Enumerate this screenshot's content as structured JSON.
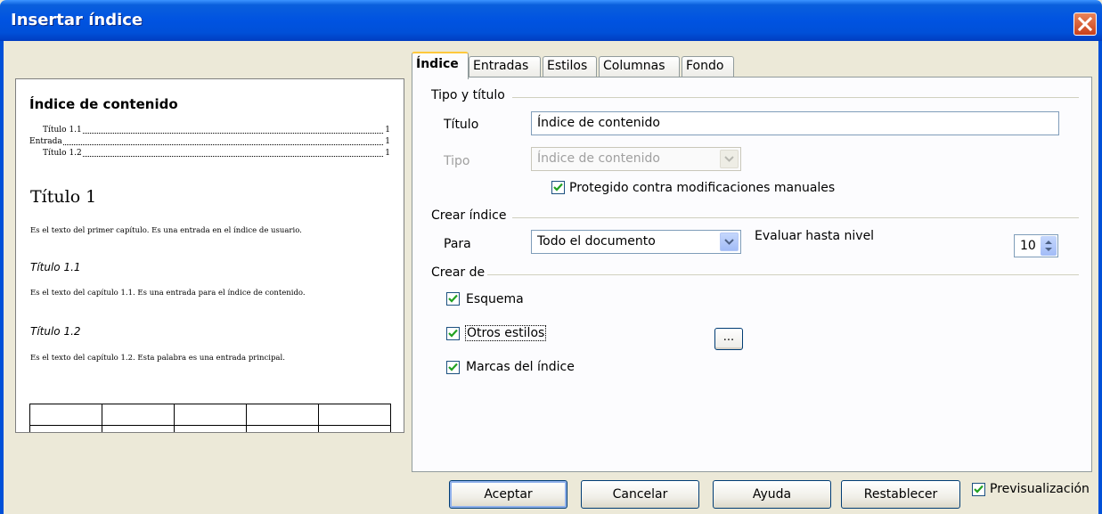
{
  "window": {
    "title": "Insertar índice"
  },
  "preview": {
    "index_heading": "Índice de contenido",
    "entries": [
      {
        "label": "Título 1.1",
        "page": "1"
      },
      {
        "label": "Entrada",
        "page": "1"
      },
      {
        "label": "Título 1.2",
        "page": "1"
      }
    ],
    "heading1": "Título 1",
    "body1": "Es el texto del primer capítulo. Es una entrada en el índice de usuario.",
    "heading11": "Título 1.1",
    "body11": "Es el texto del capítulo 1.1. Es una entrada para el índice de contenido.",
    "heading12": "Título 1.2",
    "body12": "Es el texto del capítulo 1.2. Esta palabra es una entrada principal."
  },
  "tabs": [
    "Índice",
    "Entradas",
    "Estilos",
    "Columnas",
    "Fondo"
  ],
  "type_title": {
    "section": "Tipo y título",
    "title_label": "Título",
    "title_value": "Índice de contenido",
    "type_label": "Tipo",
    "type_value": "Índice de contenido",
    "protected_label": "Protegido contra modificaciones manuales",
    "protected_checked": true
  },
  "create_index": {
    "section": "Crear índice",
    "for_label": "Para",
    "for_value": "Todo el documento",
    "eval_label": "Evaluar hasta nivel",
    "level_value": "10"
  },
  "create_from": {
    "section": "Crear de",
    "outline_label": "Esquema",
    "other_styles_label": "Otros estilos",
    "other_styles_button": "...",
    "index_marks_label": "Marcas del índice"
  },
  "buttons": {
    "ok": "Aceptar",
    "cancel": "Cancelar",
    "help": "Ayuda",
    "reset": "Restablecer",
    "preview_label": "Previsualización"
  },
  "colors": {
    "titlebar": "#0050d8",
    "dialog_bg": "#ece9d8",
    "check": "#21a121",
    "close": "#e0572b"
  },
  "icons": [
    "close-icon",
    "chevron-down-icon",
    "spin-updown-icon",
    "check-icon"
  ]
}
